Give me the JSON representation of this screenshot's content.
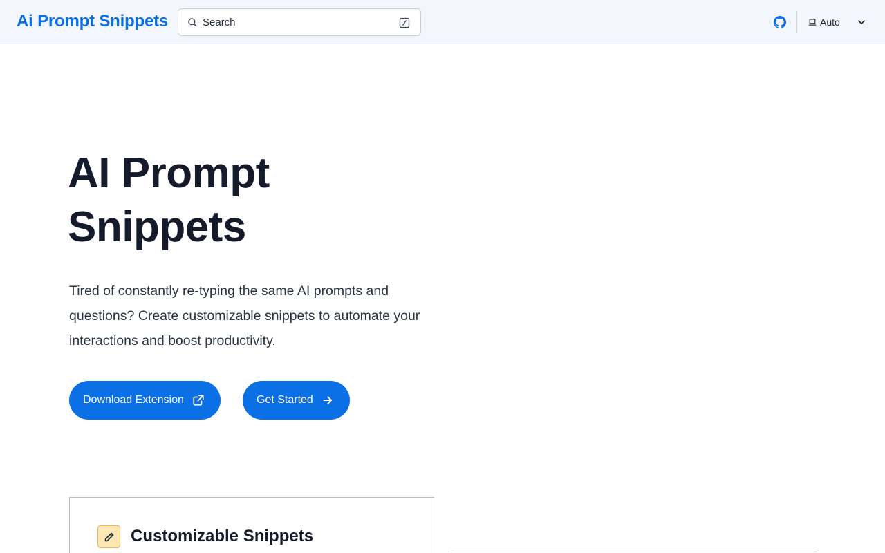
{
  "header": {
    "brand": "Ai Prompt Snippets",
    "search": {
      "placeholder": "Search"
    },
    "theme_label": "Auto"
  },
  "hero": {
    "title_line1": "AI Prompt",
    "title_line2": "Snippets",
    "description": "Tired of constantly re-typing the same AI prompts and questions? Create customizable snippets to automate your interactions and boost productivity.",
    "download_label": "Download Extension",
    "start_label": "Get Started"
  },
  "features": {
    "card1_title": "Customizable Snippets"
  },
  "colors": {
    "accent": "#0b6fe6",
    "header_bg": "#f3f6fc",
    "title_text": "#151b2b"
  },
  "icons": [
    "search-icon",
    "slash-key-icon",
    "github-icon",
    "laptop-icon",
    "chevron-down-icon",
    "external-link-icon",
    "arrow-right-icon",
    "pencil-icon"
  ]
}
